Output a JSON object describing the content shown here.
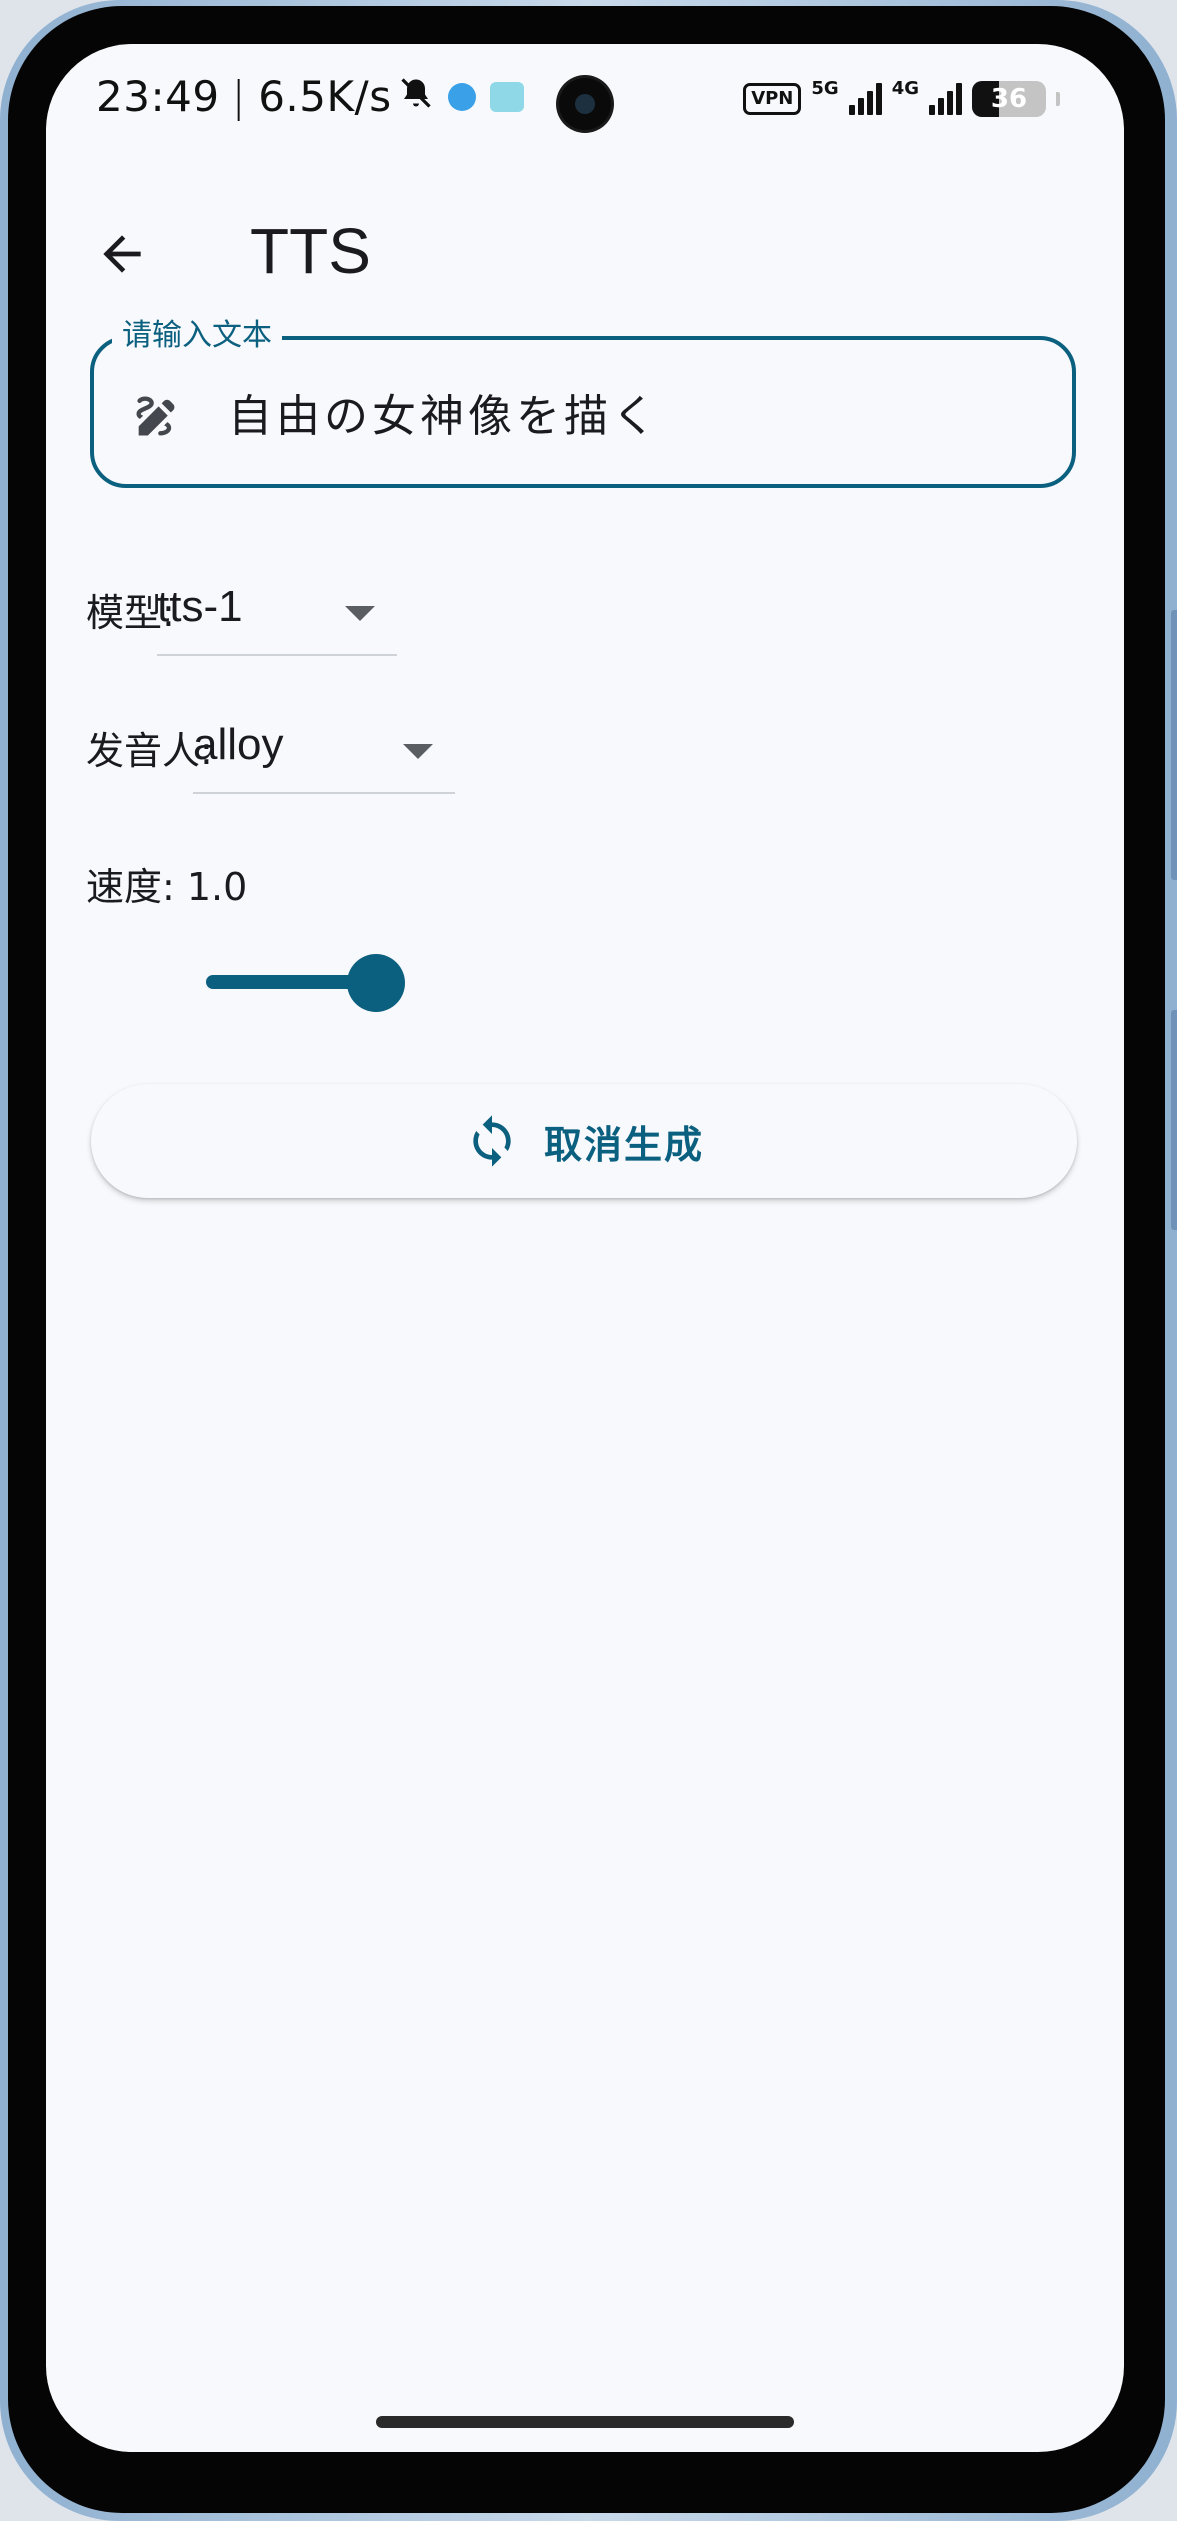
{
  "status_bar": {
    "time": "23:49",
    "net_speed": "6.5K/s",
    "vpn": "VPN",
    "net_5g": "5G",
    "net_4g": "4G",
    "battery": "36"
  },
  "app_bar": {
    "back_icon": "arrow-left-icon",
    "title": "TTS"
  },
  "text_input": {
    "label": "请输入文本",
    "value": "自由の女神像を描く",
    "icon": "draw-icon"
  },
  "model": {
    "label": "模型:",
    "selected": "tts-1"
  },
  "voice": {
    "label": "发音人:",
    "selected": "alloy"
  },
  "speed": {
    "label": "速度: 1.0",
    "value": 1.0,
    "fraction": 1.0
  },
  "action_button": {
    "label": "取消生成",
    "icon": "sync-icon"
  },
  "colors": {
    "primary": "#0b5f7f",
    "background": "#f7f9fc",
    "text": "#1b1b1f"
  }
}
